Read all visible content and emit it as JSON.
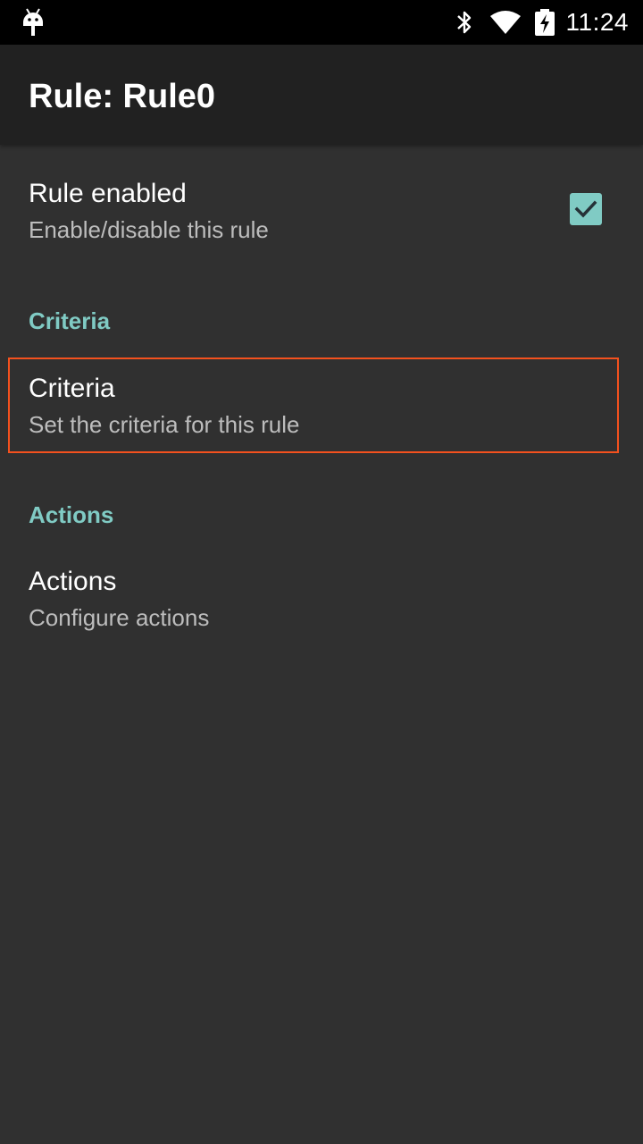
{
  "status_bar": {
    "time": "11:24",
    "icons": [
      "android-icon",
      "bluetooth-icon",
      "wifi-icon",
      "battery-charging-icon"
    ]
  },
  "toolbar": {
    "title": "Rule: Rule0"
  },
  "preferences": {
    "rule_enabled": {
      "title": "Rule enabled",
      "summary": "Enable/disable this rule",
      "checked": true
    },
    "criteria_category": "Criteria",
    "criteria": {
      "title": "Criteria",
      "summary": "Set the criteria for this rule"
    },
    "actions_category": "Actions",
    "actions": {
      "title": "Actions",
      "summary": "Configure actions"
    }
  },
  "colors": {
    "background": "#303030",
    "toolbar": "#212121",
    "accent": "#80cbc4",
    "highlight_border": "#f4511e"
  }
}
